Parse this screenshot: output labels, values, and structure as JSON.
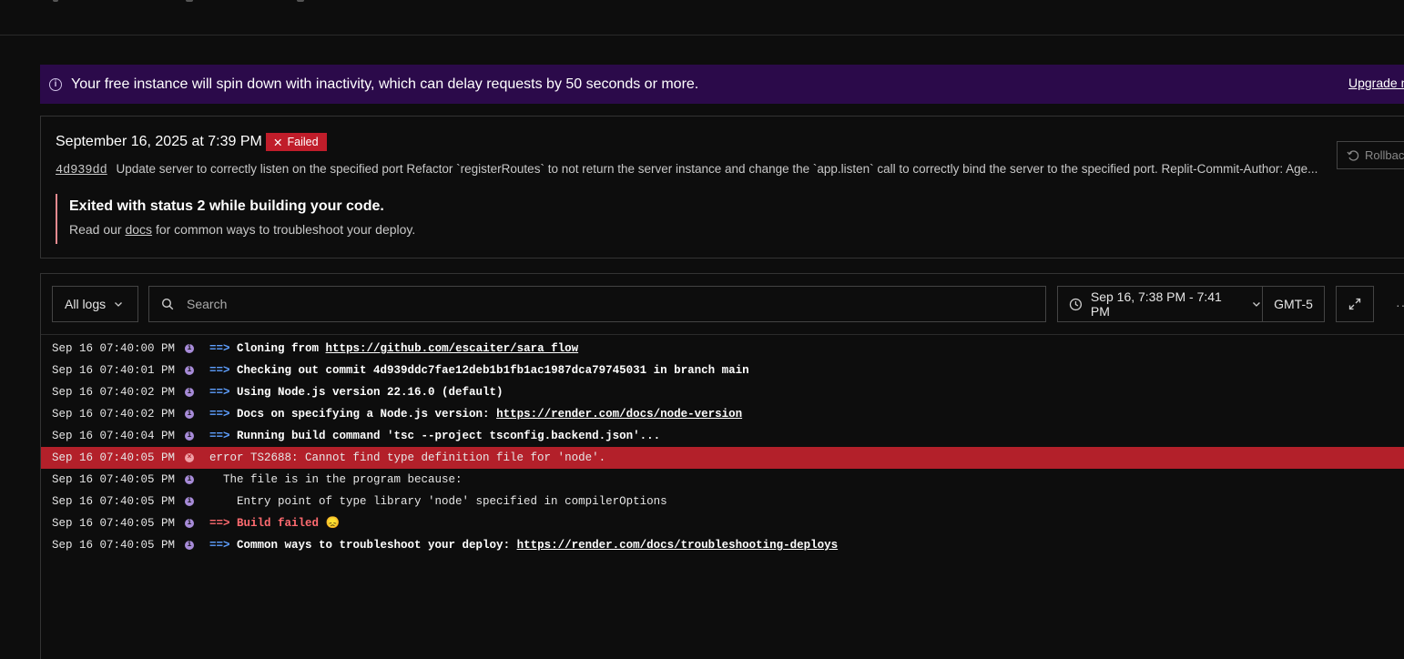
{
  "banner": {
    "message": "Your free instance will spin down with inactivity, which can delay requests by 50 seconds or more.",
    "upgrade_label": "Upgrade n"
  },
  "deploy": {
    "date": "September 16, 2025 at 7:39 PM",
    "status": "Failed",
    "commit_hash": "4d939dd",
    "commit_message": "Update server to correctly listen on the specified port Refactor `registerRoutes` to not return the server instance and change the `app.listen` call to correctly bind the server to the specified port. Replit-Commit-Author: Age...",
    "rollback_label": "Rollbac",
    "error_title": "Exited with status 2 while building your code.",
    "help_prefix": "Read our ",
    "help_link": "docs",
    "help_suffix": " for common ways to troubleshoot your deploy."
  },
  "logs_toolbar": {
    "filter_label": "All logs",
    "search_placeholder": "Search",
    "range_label": "Sep 16, 7:38 PM - 7:41 PM",
    "timezone": "GMT-5",
    "more_label": "···"
  },
  "logs": [
    {
      "time": "Sep 16 07:40:00 PM",
      "level": "info",
      "prefix": "==> ",
      "text": "Cloning from ",
      "link": "https://github.com/escaiter/sara_flow"
    },
    {
      "time": "Sep 16 07:40:01 PM",
      "level": "info",
      "prefix": "==> ",
      "text": "Checking out commit 4d939ddc7fae12deb1b1fb1ac1987dca79745031 in branch main",
      "link": ""
    },
    {
      "time": "Sep 16 07:40:02 PM",
      "level": "info",
      "prefix": "==> ",
      "text": "Using Node.js version 22.16.0 (default)",
      "link": ""
    },
    {
      "time": "Sep 16 07:40:02 PM",
      "level": "info",
      "prefix": "==> ",
      "text": "Docs on specifying a Node.js version: ",
      "link": "https://render.com/docs/node-version"
    },
    {
      "time": "Sep 16 07:40:04 PM",
      "level": "info",
      "prefix": "==> ",
      "text": "Running build command 'tsc --project tsconfig.backend.json'...",
      "link": ""
    },
    {
      "time": "Sep 16 07:40:05 PM",
      "level": "error",
      "prefix": "",
      "text": "error TS2688: Cannot find type definition file for 'node'.",
      "link": ""
    },
    {
      "time": "Sep 16 07:40:05 PM",
      "level": "info",
      "prefix": "",
      "text": "  The file is in the program because:",
      "link": ""
    },
    {
      "time": "Sep 16 07:40:05 PM",
      "level": "info",
      "prefix": "",
      "text": "    Entry point of type library 'node' specified in compilerOptions",
      "link": ""
    },
    {
      "time": "Sep 16 07:40:05 PM",
      "level": "info",
      "prefix": "==> ",
      "text": "Build failed 😞",
      "link": "",
      "style": "failed"
    },
    {
      "time": "Sep 16 07:40:05 PM",
      "level": "info",
      "prefix": "==> ",
      "text": "Common ways to troubleshoot your deploy: ",
      "link": "https://render.com/docs/troubleshooting-deploys"
    }
  ]
}
